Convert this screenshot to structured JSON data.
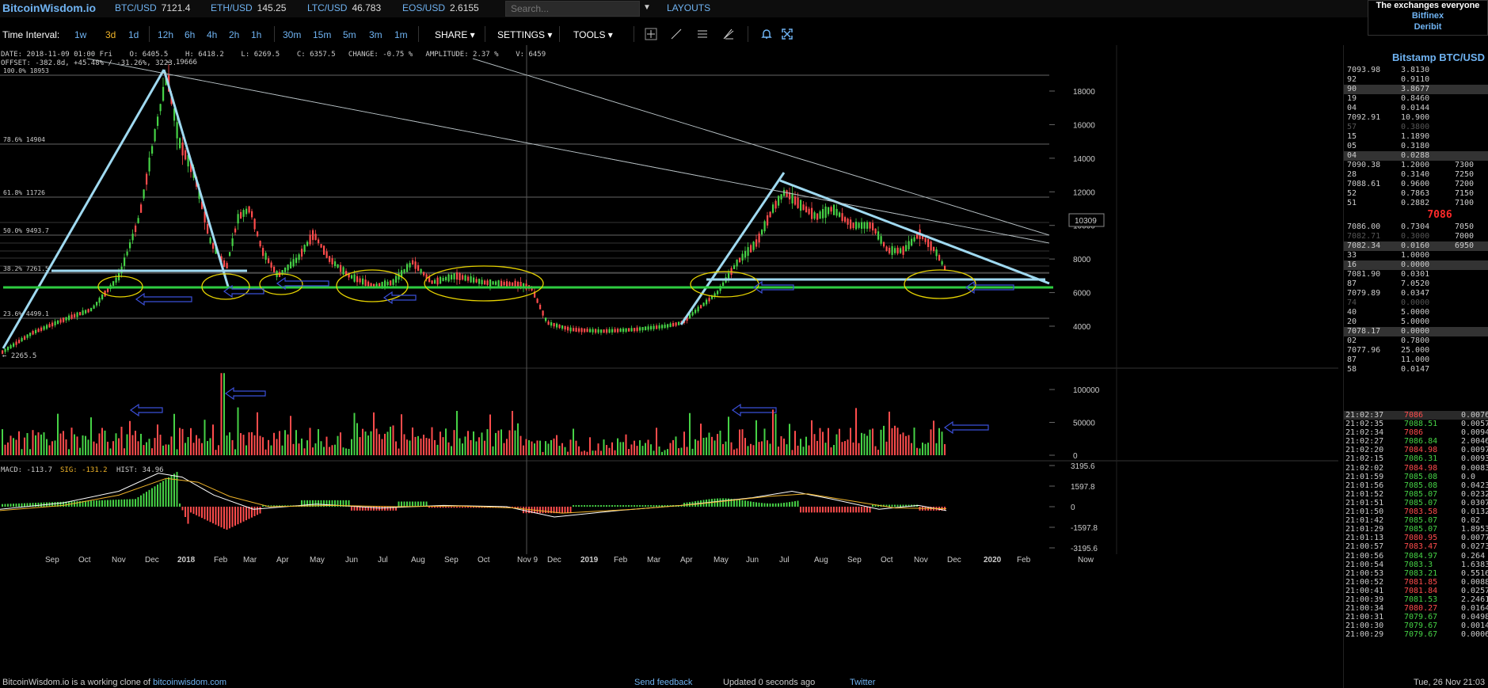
{
  "brand": "BitcoinWisdom.io",
  "tickers": [
    {
      "pair": "BTC/USD",
      "price": "7121.4"
    },
    {
      "pair": "ETH/USD",
      "price": "145.25"
    },
    {
      "pair": "LTC/USD",
      "price": "46.783"
    },
    {
      "pair": "EOS/USD",
      "price": "2.6155"
    }
  ],
  "search": {
    "placeholder": "Search..."
  },
  "layouts_label": "LAYOUTS",
  "exchanges": {
    "header": "The exchanges everyone",
    "items": [
      "Bitfinex",
      "Deribit"
    ]
  },
  "toolbar": {
    "time_interval_label": "Time Interval:",
    "intervals": [
      "1w",
      "3d",
      "1d",
      "12h",
      "6h",
      "4h",
      "2h",
      "1h",
      "30m",
      "15m",
      "5m",
      "3m",
      "1m"
    ],
    "active_interval": "3d",
    "menus": [
      "SHARE",
      "SETTINGS",
      "TOOLS"
    ]
  },
  "info": {
    "line1": "DATE: 2018-11-09 01:00 Fri    O: 6405.5    H: 6418.2    L: 6269.5    C: 6357.5   CHANGE: -0.75 %   AMPLITUDE: 2.37 %    V: 6459",
    "line2": "OFFSET: -382.8d, +45.48% / -31.26%, 3223."
  },
  "price_axis": {
    "labels": [
      "18000",
      "16000",
      "14000",
      "12000",
      "10000",
      "8000",
      "6000",
      "4000"
    ],
    "crosshair_price": "10309"
  },
  "fib_levels": [
    {
      "label": "100.0% 18953"
    },
    {
      "label": "78.6% 14904"
    },
    {
      "label": "61.8% 11726"
    },
    {
      "label": "50.0% 9493.7"
    },
    {
      "label": "38.2% 7261.5"
    },
    {
      "label": "23.6% 4499.1"
    }
  ],
  "extremes": {
    "high": "← 19666",
    "low": "← 2265.5"
  },
  "volume_axis": {
    "labels": [
      "100000",
      "50000",
      "0"
    ]
  },
  "macd": {
    "macd_label": "MACD: -113.7",
    "sig_label": "SIG: -131.2",
    "hist_label": "HIST: 34.96",
    "axis": [
      "3195.6",
      "1597.8",
      "0",
      "-1597.8",
      "-3195.6"
    ]
  },
  "x_axis": {
    "labels": [
      "Sep",
      "Oct",
      "Nov",
      "Dec",
      "2018",
      "Feb",
      "Mar",
      "Apr",
      "May",
      "Jun",
      "Jul",
      "Aug",
      "Sep",
      "Oct",
      "Nov 9",
      "Dec",
      "2019",
      "Feb",
      "Mar",
      "Apr",
      "May",
      "Jun",
      "Jul",
      "Aug",
      "Sep",
      "Oct",
      "Nov",
      "Dec",
      "2020",
      "Feb",
      "Now"
    ]
  },
  "orderbook": {
    "title": "Bitstamp BTC/USD",
    "asks": [
      {
        "p": "7093.98",
        "s": "3.8130",
        "t": ""
      },
      {
        "p": "92",
        "s": "0.9110",
        "t": ""
      },
      {
        "p": "90",
        "s": "3.8677",
        "t": "",
        "hl": true
      },
      {
        "p": "19",
        "s": "0.8460",
        "t": ""
      },
      {
        "p": "04",
        "s": "0.0144",
        "t": ""
      },
      {
        "p": "7092.91",
        "s": "10.900",
        "t": ""
      },
      {
        "p": "57",
        "s": "0.3800",
        "t": "",
        "dim": true
      },
      {
        "p": "15",
        "s": "1.1890",
        "t": ""
      },
      {
        "p": "05",
        "s": "0.3180",
        "t": ""
      },
      {
        "p": "04",
        "s": "0.0288",
        "t": "",
        "hl": true
      },
      {
        "p": "7090.38",
        "s": "1.2000",
        "t": "7300"
      },
      {
        "p": "28",
        "s": "0.3140",
        "t": "7250"
      },
      {
        "p": "7088.61",
        "s": "0.9600",
        "t": "7200"
      },
      {
        "p": "52",
        "s": "0.7863",
        "t": "7150"
      },
      {
        "p": "51",
        "s": "0.2882",
        "t": "7100"
      }
    ],
    "last": "7086",
    "bids": [
      {
        "p": "7086.00",
        "s": "0.7304",
        "t": "7050"
      },
      {
        "p": "7082.71",
        "s": "0.3000",
        "t": "7000",
        "dim": true
      },
      {
        "p": "7082.34",
        "s": "0.0160",
        "t": "6950",
        "hl": true
      },
      {
        "p": "33",
        "s": "1.0000",
        "t": ""
      },
      {
        "p": "16",
        "s": "0.0000",
        "t": "",
        "hl": true
      },
      {
        "p": "7081.90",
        "s": "0.0301",
        "t": ""
      },
      {
        "p": "87",
        "s": "7.0520",
        "t": ""
      },
      {
        "p": "7079.89",
        "s": "0.0347",
        "t": ""
      },
      {
        "p": "74",
        "s": "0.0000",
        "t": "",
        "dim": true
      },
      {
        "p": "40",
        "s": "5.0000",
        "t": ""
      },
      {
        "p": "20",
        "s": "5.0000",
        "t": ""
      },
      {
        "p": "7078.17",
        "s": "0.0000",
        "t": "",
        "hl": true
      },
      {
        "p": "02",
        "s": "0.7800",
        "t": ""
      },
      {
        "p": "7077.96",
        "s": "25.000",
        "t": ""
      },
      {
        "p": "87",
        "s": "11.000",
        "t": ""
      },
      {
        "p": "58",
        "s": "0.0147",
        "t": ""
      }
    ]
  },
  "trades": [
    {
      "time": "21:02:37",
      "price": "7086",
      "amount": "0.0076",
      "dir": "dn"
    },
    {
      "time": "21:02:35",
      "price": "7088.51",
      "amount": "0.0057",
      "dir": "up"
    },
    {
      "time": "21:02:34",
      "price": "7086",
      "amount": "0.0094",
      "dir": "dn"
    },
    {
      "time": "21:02:27",
      "price": "7086.84",
      "amount": "2.0046",
      "dir": "up"
    },
    {
      "time": "21:02:20",
      "price": "7084.98",
      "amount": "0.0097",
      "dir": "dn"
    },
    {
      "time": "21:02:15",
      "price": "7086.31",
      "amount": "0.0093",
      "dir": "up"
    },
    {
      "time": "21:02:02",
      "price": "7084.98",
      "amount": "0.0083",
      "dir": "dn"
    },
    {
      "time": "21:01:59",
      "price": "7085.08",
      "amount": "0.0",
      "dir": "up"
    },
    {
      "time": "21:01:56",
      "price": "7085.08",
      "amount": "0.0423",
      "dir": "up"
    },
    {
      "time": "21:01:52",
      "price": "7085.07",
      "amount": "0.0232",
      "dir": "up"
    },
    {
      "time": "21:01:51",
      "price": "7085.07",
      "amount": "0.0307",
      "dir": "up"
    },
    {
      "time": "21:01:50",
      "price": "7083.58",
      "amount": "0.0132",
      "dir": "dn"
    },
    {
      "time": "21:01:42",
      "price": "7085.07",
      "amount": "0.02",
      "dir": "up"
    },
    {
      "time": "21:01:29",
      "price": "7085.07",
      "amount": "1.8953",
      "dir": "up"
    },
    {
      "time": "21:01:13",
      "price": "7080.95",
      "amount": "0.0077",
      "dir": "dn"
    },
    {
      "time": "21:00:57",
      "price": "7083.47",
      "amount": "0.0273",
      "dir": "dn"
    },
    {
      "time": "21:00:56",
      "price": "7084.97",
      "amount": "0.264",
      "dir": "up"
    },
    {
      "time": "21:00:54",
      "price": "7083.3",
      "amount": "1.6383",
      "dir": "up"
    },
    {
      "time": "21:00:53",
      "price": "7083.21",
      "amount": "0.5516",
      "dir": "up"
    },
    {
      "time": "21:00:52",
      "price": "7081.85",
      "amount": "0.0088",
      "dir": "dn"
    },
    {
      "time": "21:00:41",
      "price": "7081.84",
      "amount": "0.0257",
      "dir": "dn"
    },
    {
      "time": "21:00:39",
      "price": "7081.53",
      "amount": "2.2461",
      "dir": "up"
    },
    {
      "time": "21:00:34",
      "price": "7080.27",
      "amount": "0.0164",
      "dir": "dn"
    },
    {
      "time": "21:00:31",
      "price": "7079.67",
      "amount": "0.0498",
      "dir": "up"
    },
    {
      "time": "21:00:30",
      "price": "7079.67",
      "amount": "0.0014",
      "dir": "up"
    },
    {
      "time": "21:00:29",
      "price": "7079.67",
      "amount": "0.0006",
      "dir": "up"
    }
  ],
  "footer": {
    "clone_text": "BitcoinWisdom.io is a working clone of",
    "clone_link": "bitcoinwisdom.com",
    "feedback": "Send feedback",
    "updated": "Updated 0 seconds ago",
    "twitter": "Twitter",
    "date": "Tue, 26 Nov 21:03"
  },
  "colors": {
    "accent": "#6fb3f2",
    "up": "#46d246",
    "down": "#ff4c4c",
    "drawing": "#9fd9f0",
    "support": "#2ecc40",
    "ellipse": "#e8d400"
  }
}
